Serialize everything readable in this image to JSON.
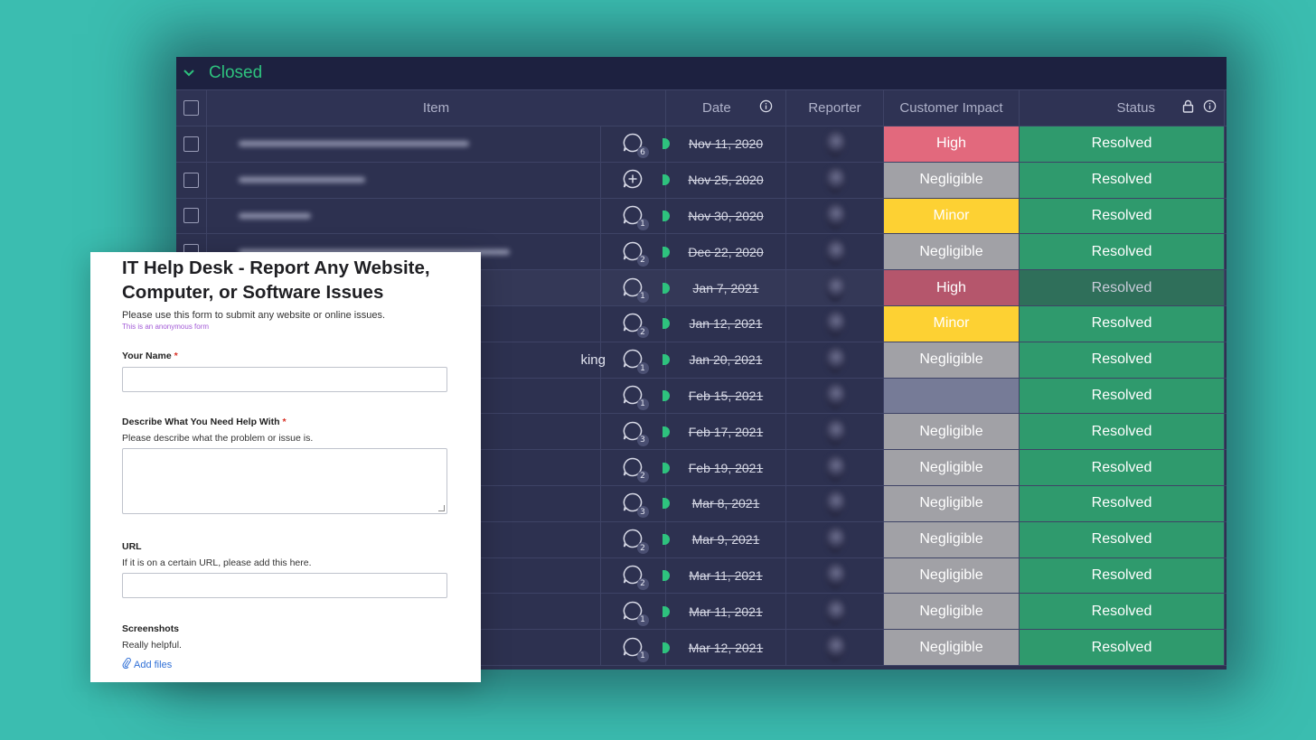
{
  "board": {
    "group_title": "Closed",
    "columns": {
      "item": "Item",
      "date": "Date",
      "reporter": "Reporter",
      "impact": "Customer Impact",
      "status": "Status"
    },
    "rows": [
      {
        "updates": "6",
        "date": "Nov 11, 2020",
        "impact": "High",
        "status": "Resolved"
      },
      {
        "updates": "+",
        "date": "Nov 25, 2020",
        "impact": "Negligible",
        "status": "Resolved"
      },
      {
        "updates": "1",
        "date": "Nov 30, 2020",
        "impact": "Minor",
        "status": "Resolved"
      },
      {
        "updates": "2",
        "date": "Dec 22, 2020",
        "impact": "Negligible",
        "status": "Resolved"
      },
      {
        "updates": "1",
        "date": "Jan 7, 2021",
        "impact": "High",
        "status": "Resolved"
      },
      {
        "updates": "2",
        "date": "Jan 12, 2021",
        "impact": "Minor",
        "status": "Resolved"
      },
      {
        "updates": "1",
        "date": "Jan 20, 2021",
        "impact": "Negligible",
        "status": "Resolved",
        "item_fragment": "king"
      },
      {
        "updates": "1",
        "date": "Feb 15, 2021",
        "impact": "",
        "status": "Resolved"
      },
      {
        "updates": "3",
        "date": "Feb 17, 2021",
        "impact": "Negligible",
        "status": "Resolved"
      },
      {
        "updates": "2",
        "date": "Feb 19, 2021",
        "impact": "Negligible",
        "status": "Resolved"
      },
      {
        "updates": "3",
        "date": "Mar 8, 2021",
        "impact": "Negligible",
        "status": "Resolved"
      },
      {
        "updates": "2",
        "date": "Mar 9, 2021",
        "impact": "Negligible",
        "status": "Resolved"
      },
      {
        "updates": "2",
        "date": "Mar 11, 2021",
        "impact": "Negligible",
        "status": "Resolved"
      },
      {
        "updates": "1",
        "date": "Mar 11, 2021",
        "impact": "Negligible",
        "status": "Resolved"
      },
      {
        "updates": "1",
        "date": "Mar 12, 2021",
        "impact": "Negligible",
        "status": "Resolved"
      }
    ],
    "colors": {
      "high": "#e2697d",
      "negligible": "#a1a1a6",
      "minor": "#fdd133",
      "resolved": "#2f9a6d",
      "group_accent": "#2ec27e"
    }
  },
  "form": {
    "title": "IT Help Desk - Report Any Website, Computer, or Software Issues",
    "description": "Please use this form to submit any website or online issues.",
    "anonymous_note": "This is an anonymous form",
    "fields": {
      "name": {
        "label": "Your Name",
        "required": "*"
      },
      "help": {
        "label": "Describe What You Need Help With",
        "required": "*",
        "help": "Please describe what the problem or issue is."
      },
      "url": {
        "label": "URL",
        "help": "If it is on a certain URL, please add this here."
      },
      "screenshots": {
        "label": "Screenshots",
        "help": "Really helpful.",
        "add_files": "Add files"
      }
    }
  }
}
